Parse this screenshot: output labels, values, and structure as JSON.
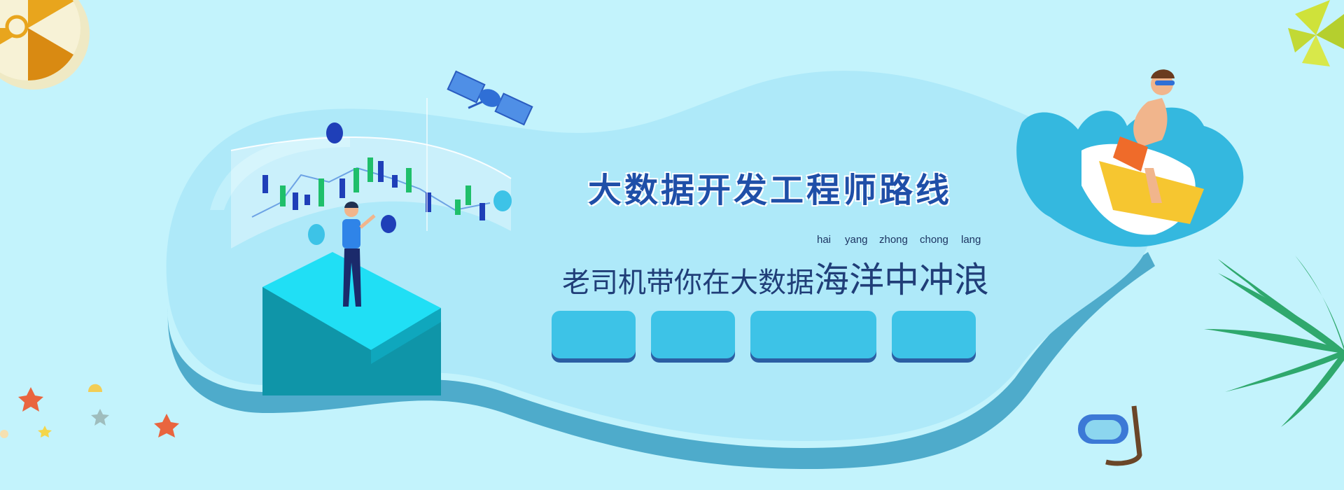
{
  "banner": {
    "title": "大数据开发工程师路线",
    "subtitle_lead": "老司机带你在大数据",
    "subtitle_emph": "海洋中冲浪",
    "pinyin": [
      "hai",
      "yang",
      "zhong",
      "chong",
      "lang"
    ]
  },
  "buttons": [
    {
      "label": ""
    },
    {
      "label": ""
    },
    {
      "label": ""
    },
    {
      "label": ""
    }
  ],
  "colors": {
    "background": "#c3f3fc",
    "island": "#aee9f9",
    "island_side": "#3a9ec2",
    "title": "#1f4fa8",
    "button": "#3dc3e7",
    "button_shadow": "#2b5ea3"
  },
  "icons": [
    "beach-ball-icon",
    "pinwheel-icon",
    "satellite-icon",
    "person-icon",
    "surfer-icon",
    "palm-leaf-icon",
    "snorkel-mask-icon",
    "starfish-icon",
    "seashell-icon",
    "candlestick-chart-icon"
  ]
}
